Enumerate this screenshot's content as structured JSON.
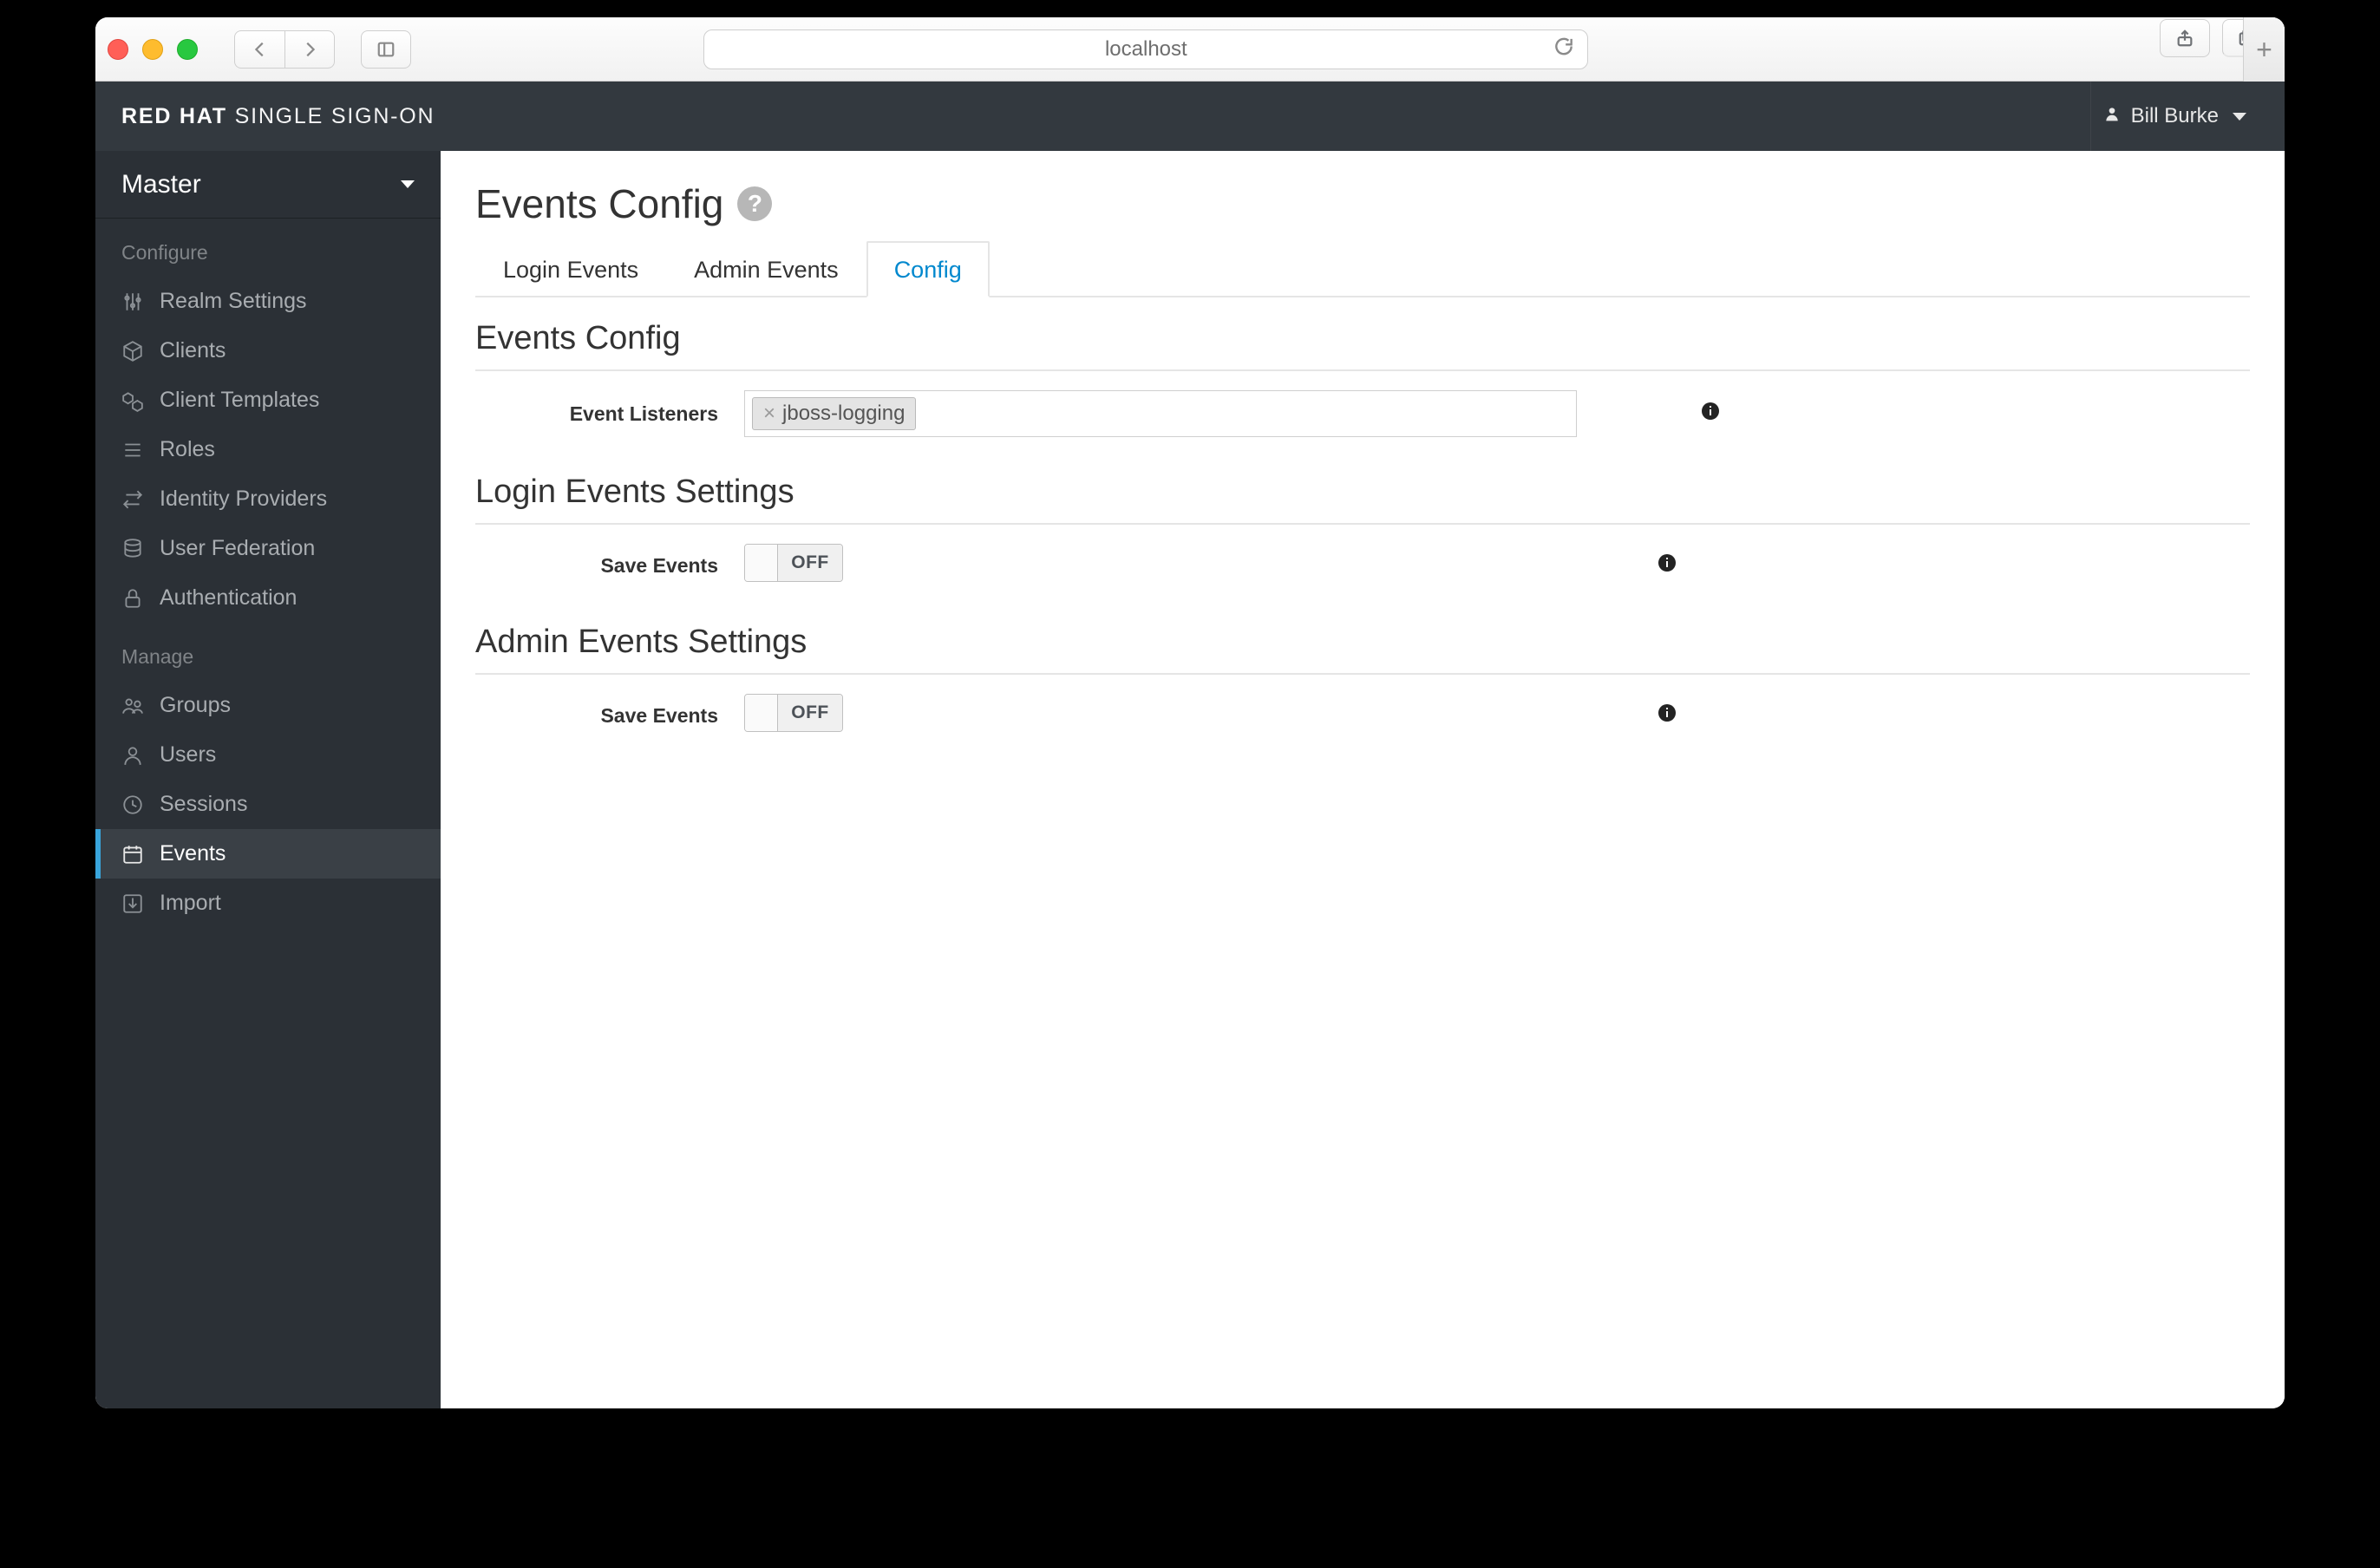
{
  "browser": {
    "url": "localhost"
  },
  "header": {
    "brand_bold": "RED HAT",
    "brand_thin": "SINGLE SIGN-ON",
    "user_name": "Bill Burke"
  },
  "sidebar": {
    "realm": "Master",
    "section_configure": "Configure",
    "section_manage": "Manage",
    "items_configure": [
      {
        "id": "realm-settings",
        "label": "Realm Settings"
      },
      {
        "id": "clients",
        "label": "Clients"
      },
      {
        "id": "client-templates",
        "label": "Client Templates"
      },
      {
        "id": "roles",
        "label": "Roles"
      },
      {
        "id": "identity-providers",
        "label": "Identity Providers"
      },
      {
        "id": "user-federation",
        "label": "User Federation"
      },
      {
        "id": "authentication",
        "label": "Authentication"
      }
    ],
    "items_manage": [
      {
        "id": "groups",
        "label": "Groups"
      },
      {
        "id": "users",
        "label": "Users"
      },
      {
        "id": "sessions",
        "label": "Sessions"
      },
      {
        "id": "events",
        "label": "Events"
      },
      {
        "id": "import",
        "label": "Import"
      }
    ],
    "active_item": "events"
  },
  "page": {
    "title": "Events Config",
    "tabs": [
      {
        "id": "login-events",
        "label": "Login Events"
      },
      {
        "id": "admin-events",
        "label": "Admin Events"
      },
      {
        "id": "config",
        "label": "Config"
      }
    ],
    "active_tab": "config",
    "sections": {
      "events_config_heading": "Events Config",
      "login_events_heading": "Login Events Settings",
      "admin_events_heading": "Admin Events Settings"
    },
    "fields": {
      "event_listeners_label": "Event Listeners",
      "event_listeners_values": [
        "jboss-logging"
      ],
      "login_save_events_label": "Save Events",
      "login_save_events_state": "OFF",
      "admin_save_events_label": "Save Events",
      "admin_save_events_state": "OFF"
    }
  }
}
